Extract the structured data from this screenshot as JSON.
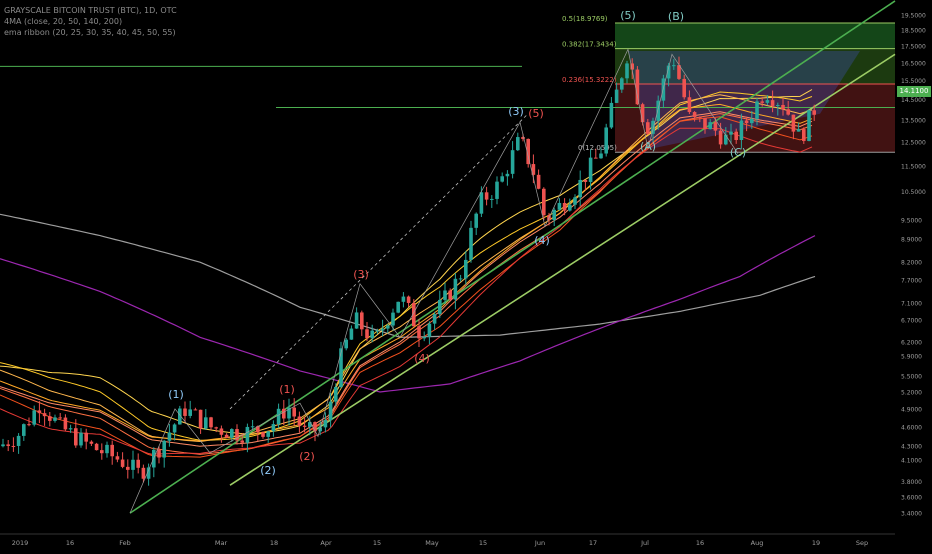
{
  "legend": {
    "title": "GRAYSCALE BITCOIN TRUST (BTC), 1D, OTC",
    "ma": "4MA (close, 20, 50, 140, 200)",
    "ribbon": "ema ribbon (20, 25, 30, 35, 40, 45, 50, 55)"
  },
  "last_price": "14.1100",
  "colors": {
    "up": "#26a69a",
    "down": "#ef5350",
    "trend_green": "#4caf50",
    "fib_green": "#9ccc65",
    "fib_red": "#ef5350",
    "ma140": "#9c27b0",
    "ma200": "#9e9e9e",
    "blue_label": "#90caf9",
    "red_label": "#ef5350",
    "teal_label": "#80cbc4"
  },
  "chart_data": {
    "type": "candlestick",
    "y_scale": "log",
    "ylim": [
      3.25,
      20.0
    ],
    "y_ticks": [
      "19.5000",
      "18.5000",
      "17.5000",
      "16.5000",
      "15.5000",
      "14.5000",
      "13.5000",
      "12.5000",
      "11.5000",
      "10.5000",
      "9.5000",
      "8.9000",
      "8.2000",
      "7.7000",
      "7.1000",
      "6.7000",
      "6.2000",
      "5.9000",
      "5.5000",
      "5.2000",
      "4.9000",
      "4.6000",
      "4.3000",
      "4.1000",
      "3.8000",
      "3.6000",
      "3.4000"
    ],
    "x_labels": [
      "2019",
      "16",
      "Feb",
      "Mar",
      "18",
      "Apr",
      "15",
      "May",
      "15",
      "Jun",
      "17",
      "Jul",
      "16",
      "Aug",
      "19",
      "Sep"
    ],
    "fib_levels": [
      {
        "label": "0.5(18.9769)",
        "value": 18.9769
      },
      {
        "label": "0.382(17.3434)",
        "value": 17.3434
      },
      {
        "label": "0.236(15.3222)",
        "value": 15.3222
      },
      {
        "label": "0(12.0595)",
        "value": 12.0595
      }
    ],
    "horizontal_lines": [
      14.11,
      16.3
    ],
    "wave_labels": [
      "(1)",
      "(2)",
      "(3)",
      "(4)",
      "(5)",
      "(1)",
      "(2)",
      "(3)",
      "(4)",
      "(3)",
      "(5)",
      "(A)",
      "(B)",
      "(C)"
    ],
    "ma140_anchors": [
      [
        0,
        8.3
      ],
      [
        100,
        7.4
      ],
      [
        200,
        6.3
      ],
      [
        300,
        5.6
      ],
      [
        380,
        5.2
      ],
      [
        450,
        5.35
      ],
      [
        520,
        5.8
      ],
      [
        600,
        6.5
      ],
      [
        680,
        7.2
      ],
      [
        740,
        7.8
      ],
      [
        815,
        9.0
      ]
    ],
    "ma200_anchors": [
      [
        0,
        9.7
      ],
      [
        100,
        9.0
      ],
      [
        200,
        8.2
      ],
      [
        300,
        7.0
      ],
      [
        400,
        6.3
      ],
      [
        500,
        6.35
      ],
      [
        600,
        6.6
      ],
      [
        680,
        6.9
      ],
      [
        760,
        7.3
      ],
      [
        815,
        7.8
      ]
    ],
    "ribbon_anchors": [
      [
        0,
        5.3
      ],
      [
        50,
        5.0
      ],
      [
        100,
        4.85
      ],
      [
        150,
        4.4
      ],
      [
        200,
        4.3
      ],
      [
        250,
        4.35
      ],
      [
        300,
        4.5
      ],
      [
        330,
        4.8
      ],
      [
        360,
        5.7
      ],
      [
        400,
        6.2
      ],
      [
        440,
        6.9
      ],
      [
        480,
        7.9
      ],
      [
        520,
        8.8
      ],
      [
        560,
        9.6
      ],
      [
        600,
        10.8
      ],
      [
        640,
        12.2
      ],
      [
        680,
        13.6
      ],
      [
        720,
        13.9
      ],
      [
        760,
        13.5
      ],
      [
        800,
        13.2
      ],
      [
        815,
        13.5
      ]
    ],
    "ribbon_offsets": [
      0.12,
      0.09,
      0.06,
      0.03,
      0.0,
      -0.03,
      -0.06,
      -0.09
    ],
    "ribbon_colors": [
      "#ffd54f",
      "#ffca28",
      "#ffb74d",
      "#ffa726",
      "#ff8a65",
      "#ff7043",
      "#f4511e",
      "#e53935"
    ],
    "trendlines": [
      {
        "from": [
          130,
          3.4
        ],
        "to": [
          895,
          20.5
        ],
        "color": "#4caf50"
      },
      {
        "from": [
          230,
          3.75
        ],
        "to": [
          895,
          17.0
        ],
        "color": "#9ccc65"
      }
    ],
    "candle_path": [
      [
        0,
        4.3
      ],
      [
        20,
        4.5
      ],
      [
        40,
        5.0
      ],
      [
        60,
        4.6
      ],
      [
        90,
        4.3
      ],
      [
        120,
        4.1
      ],
      [
        140,
        3.9
      ],
      [
        160,
        4.3
      ],
      [
        185,
        4.9
      ],
      [
        210,
        4.6
      ],
      [
        240,
        4.5
      ],
      [
        270,
        4.6
      ],
      [
        288,
        4.95
      ],
      [
        305,
        4.5
      ],
      [
        325,
        4.6
      ],
      [
        340,
        5.8
      ],
      [
        355,
        6.7
      ],
      [
        375,
        6.2
      ],
      [
        400,
        7.3
      ],
      [
        420,
        6.4
      ],
      [
        440,
        7.0
      ],
      [
        460,
        7.8
      ],
      [
        480,
        10.1
      ],
      [
        500,
        10.8
      ],
      [
        520,
        12.6
      ],
      [
        535,
        11.1
      ],
      [
        545,
        9.5
      ],
      [
        560,
        10.0
      ],
      [
        580,
        10.8
      ],
      [
        600,
        12.0
      ],
      [
        615,
        14.5
      ],
      [
        628,
        17.2
      ],
      [
        640,
        14.0
      ],
      [
        650,
        13.0
      ],
      [
        672,
        17.0
      ],
      [
        690,
        13.5
      ],
      [
        710,
        13.2
      ],
      [
        730,
        12.5
      ],
      [
        745,
        13.3
      ],
      [
        765,
        15.0
      ],
      [
        785,
        14.2
      ],
      [
        800,
        12.6
      ],
      [
        815,
        14.1
      ]
    ]
  }
}
